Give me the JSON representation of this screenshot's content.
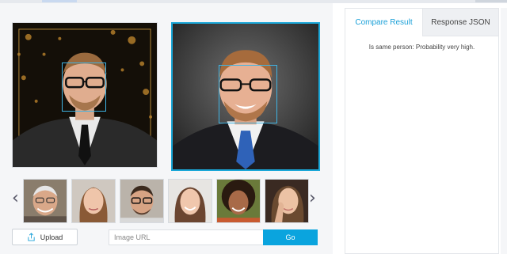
{
  "tabs": {
    "compare_label": "Compare Result",
    "json_label": "Response JSON"
  },
  "result": {
    "text": "Is same person: Probability very high."
  },
  "controls": {
    "upload_label": "Upload",
    "url_placeholder": "Image URL",
    "go_label": "Go"
  },
  "icons": {
    "prev": "chevron-left-icon",
    "next": "chevron-right-icon",
    "upload": "upload-icon"
  },
  "colors": {
    "accent": "#0aa4de",
    "face_box": "#3fb4e4"
  },
  "thumbnails": [
    "elderly-man-photo",
    "woman-photo",
    "man-with-glasses-photo",
    "smiling-woman-photo",
    "curly-haired-woman-photo",
    "woman-hand-on-face-photo"
  ]
}
